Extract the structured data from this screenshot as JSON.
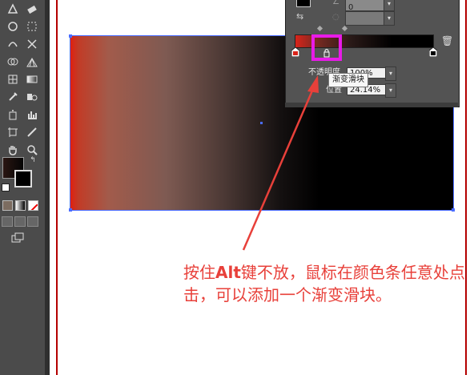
{
  "panel": {
    "tooltip": "渐变滑块",
    "opacity_label": "不透明度",
    "opacity_value": "100%",
    "location_label": "位置",
    "location_value": "24.14%",
    "angle_value": "0"
  },
  "annotation": {
    "line_before": "按住",
    "key": "Alt",
    "line_after": "键不放，鼠标在颜色条任意处点击，可以添加一个渐变滑块。"
  },
  "colors": {
    "highlight": "#e81be8",
    "arrow": "#e8403a",
    "selection": "#4a6cff"
  },
  "icons": [
    "pen-tool-icon",
    "eraser-icon",
    "lasso-icon",
    "magic-wand-icon",
    "zoom-icon",
    "hand-icon",
    "eyedropper-icon",
    "gradient-icon",
    "fill-stroke-icon",
    "swap-icon",
    "screen-mode-icon",
    "delete-stop-icon",
    "lock-icon"
  ]
}
